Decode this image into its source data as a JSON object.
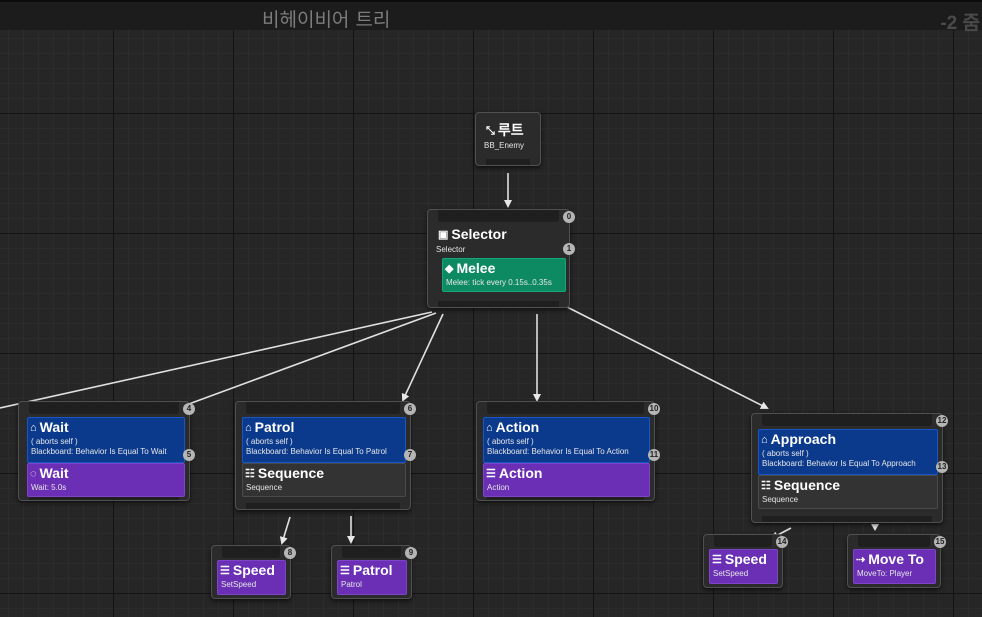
{
  "title": "비헤이비어 트리",
  "zoom": "-2 줌",
  "root": {
    "title": "루트",
    "sub": "BB_Enemy"
  },
  "selector": {
    "title": "Selector",
    "sub": "Selector",
    "index0": "0",
    "index1": "1",
    "service": {
      "title": "Melee",
      "sub": "Melee: tick every 0.15s..0.35s"
    }
  },
  "wait": {
    "index_top": "4",
    "index_dec": "5",
    "decorator": {
      "title": "Wait",
      "line1": "( aborts self )",
      "line2": "Blackboard: Behavior Is Equal To Wait"
    },
    "task": {
      "title": "Wait",
      "sub": "Wait: 5.0s"
    }
  },
  "patrol": {
    "index_top": "6",
    "index_dec": "7",
    "decorator": {
      "title": "Patrol",
      "line1": "( aborts self )",
      "line2": "Blackboard: Behavior Is Equal To Patrol"
    },
    "composite": {
      "title": "Sequence",
      "sub": "Sequence"
    }
  },
  "action": {
    "index_top": "10",
    "index_dec": "11",
    "decorator": {
      "title": "Action",
      "line1": "( aborts self )",
      "line2": "Blackboard: Behavior Is Equal To Action"
    },
    "task": {
      "title": "Action",
      "sub": "Action"
    }
  },
  "approach": {
    "index_top": "12",
    "index_dec": "13",
    "decorator": {
      "title": "Approach",
      "line1": "( aborts self )",
      "line2": "Blackboard: Behavior Is Equal To Approach"
    },
    "composite": {
      "title": "Sequence",
      "sub": "Sequence"
    }
  },
  "speed1": {
    "index": "8",
    "title": "Speed",
    "sub": "SetSpeed"
  },
  "patrol_task": {
    "index": "9",
    "title": "Patrol",
    "sub": "Patrol"
  },
  "speed2": {
    "index": "14",
    "title": "Speed",
    "sub": "SetSpeed"
  },
  "moveto": {
    "index": "15",
    "title": "Move To",
    "sub": "MoveTo: Player"
  },
  "colors": {
    "decorator": "#0b3a8c",
    "task": "#6a2fb5",
    "service": "#0e8a63",
    "composite": "#333333",
    "wire": "#e0e0e0"
  }
}
